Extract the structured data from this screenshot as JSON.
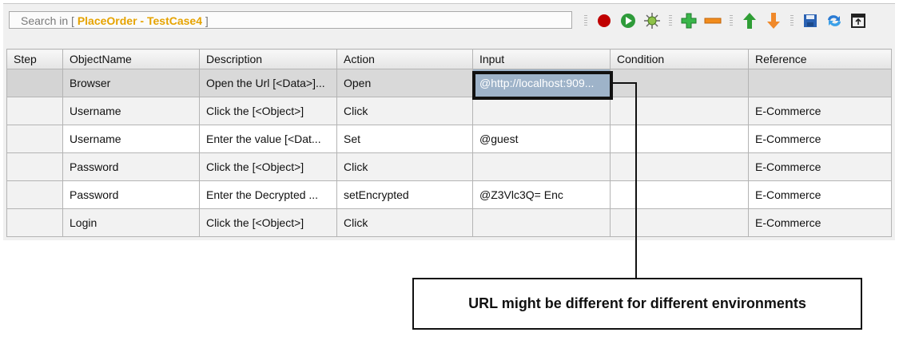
{
  "search": {
    "prefix": "Search in [",
    "scope": "PlaceOrder - TestCase4",
    "suffix": "]"
  },
  "toolbar": {
    "icons": [
      "record-icon",
      "run-icon",
      "debug-bug-icon",
      "add-row-icon",
      "remove-row-icon",
      "move-up-icon",
      "move-down-icon",
      "save-icon",
      "refresh-icon",
      "toggle-view-icon"
    ],
    "colors": {
      "record": "#c00000",
      "run": "#2e9b3a",
      "add": "#39b54a",
      "remove": "#f28c1c",
      "up": "#2f9e35",
      "down": "#f0892a",
      "save": "#2a62b3"
    }
  },
  "table": {
    "columns": [
      "Step",
      "ObjectName",
      "Description",
      "Action",
      "Input",
      "Condition",
      "Reference"
    ],
    "rows": [
      {
        "step": "",
        "object": "Browser",
        "description": "Open the Url [<Data>]...",
        "action": "Open",
        "input": "@http://localhost:909...",
        "condition": "",
        "reference": ""
      },
      {
        "step": "",
        "object": "Username",
        "description": "Click the [<Object>]",
        "action": "Click",
        "input": "",
        "condition": "",
        "reference": "E-Commerce"
      },
      {
        "step": "",
        "object": "Username",
        "description": "Enter the value [<Dat...",
        "action": "Set",
        "input": "@guest",
        "condition": "",
        "reference": "E-Commerce"
      },
      {
        "step": "",
        "object": "Password",
        "description": "Click the [<Object>]",
        "action": "Click",
        "input": "",
        "condition": "",
        "reference": "E-Commerce"
      },
      {
        "step": "",
        "object": "Password",
        "description": "Enter the Decrypted ...",
        "action": "setEncrypted",
        "input": "@Z3Vlc3Q= Enc",
        "condition": "",
        "reference": "E-Commerce"
      },
      {
        "step": "",
        "object": "Login",
        "description": "Click the [<Object>]",
        "action": "Click",
        "input": "",
        "condition": "",
        "reference": "E-Commerce"
      }
    ]
  },
  "callout": {
    "text": "URL might be different for different environments"
  }
}
